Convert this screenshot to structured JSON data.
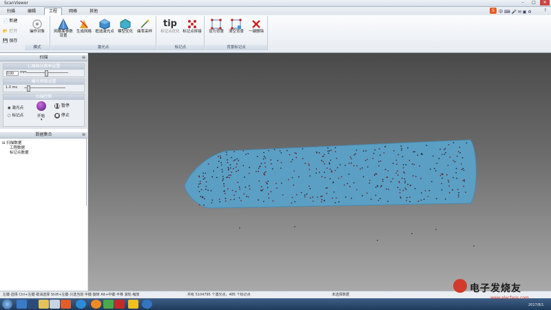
{
  "window": {
    "title": "ScanViewer"
  },
  "menu": {
    "tabs": [
      "扫描",
      "编辑",
      "工程",
      "网格",
      "其他"
    ],
    "active_index": 2
  },
  "ribbon": {
    "file_buttons": [
      "新建",
      "打开",
      "保存"
    ],
    "groups": [
      {
        "label": "模式",
        "buttons": [
          "操作对象"
        ]
      },
      {
        "label": "激光点",
        "buttons": [
          "网格面参数设置",
          "生成网格",
          "框选激光点",
          "模型优化",
          "曲率采样"
        ]
      },
      {
        "label": "标记点",
        "buttons": [
          "标记点优化",
          "标记点拼接"
        ]
      },
      {
        "label": "背景标记点",
        "buttons": [
          "设为背景",
          "清空背景",
          "一键删除"
        ]
      }
    ]
  },
  "left_panel": {
    "header": "扫描",
    "resolution_section": {
      "title": "1.网格分辨率设置",
      "value": "0.00",
      "unit": "mm"
    },
    "exposure_section": {
      "title": "曝光参数设置",
      "value": "1.0 ms"
    },
    "scan_control": {
      "title": "扫描控制",
      "radio_options": [
        "激光点",
        "标记点"
      ],
      "selected_index": 0,
      "start_label": "开始",
      "pause_label": "暂停",
      "stop_label": "停止"
    }
  },
  "data_panel": {
    "header": "数据集合",
    "tree": {
      "root": "扫描数据",
      "children": [
        "工程数据",
        "标记点数据"
      ]
    }
  },
  "status_bar": {
    "hint": "左键-选择 Ctrl+左键-取消选择 Shift+左键-只选当前 中键-旋转 Alt+中键-平移 滚轮-缩放",
    "stats": "共有 5104795 个激光点，485 个标记点",
    "selection": "未选择数据"
  },
  "taskbar": {
    "date": "2017/8/1",
    "watermark": "电子发烧友",
    "watermark_url": "www.elecfans.com"
  },
  "colors": {
    "model": "#5b9fc4",
    "viewport_top": "#4a4a4a",
    "viewport_bottom": "#a9a9a9",
    "accent": "#2b5797"
  }
}
